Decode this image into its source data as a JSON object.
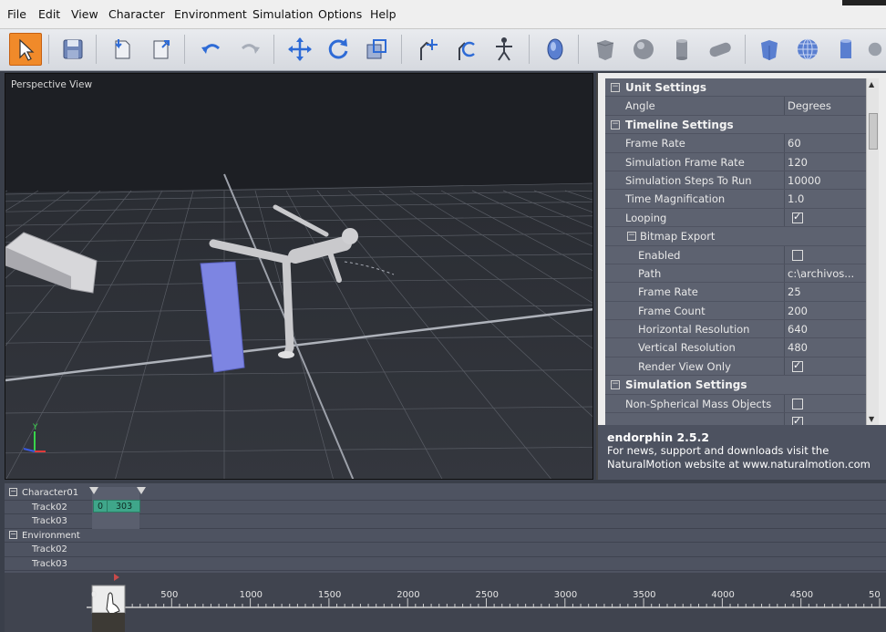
{
  "menu": [
    "File",
    "Edit",
    "View",
    "Character",
    "Environment",
    "Simulation",
    "Options",
    "Help"
  ],
  "toolbar": {
    "tools": [
      "select-tool",
      "save-tool",
      "open-tool",
      "export-tool",
      "undo-tool",
      "redo-tool",
      "move-tool",
      "rotate-tool",
      "scale-tool",
      "character-pose-tool",
      "character-rotate-tool",
      "character-tool",
      "head-object-tool",
      "box-object-tool",
      "sphere-object-tool",
      "cylinder-object-tool",
      "capsule-object-tool",
      "cube-env-tool",
      "globe-env-tool",
      "column-env-tool",
      "extra-tool"
    ]
  },
  "viewport": {
    "label": "Perspective View",
    "axis_y": "Y"
  },
  "properties": {
    "rows": [
      {
        "type": "section",
        "key": "Unit Settings"
      },
      {
        "type": "prop",
        "key": "Angle",
        "value": "Degrees"
      },
      {
        "type": "section",
        "key": "Timeline Settings"
      },
      {
        "type": "prop",
        "key": "Frame Rate",
        "value": "60"
      },
      {
        "type": "prop",
        "key": "Simulation Frame Rate",
        "value": "120"
      },
      {
        "type": "prop",
        "key": "Simulation Steps To Run",
        "value": "10000"
      },
      {
        "type": "prop",
        "key": "Time Magnification",
        "value": "1.0"
      },
      {
        "type": "check",
        "key": "Looping",
        "checked": true
      },
      {
        "type": "sub",
        "key": "Bitmap Export"
      },
      {
        "type": "check",
        "key": "Enabled",
        "checked": false,
        "indent": true
      },
      {
        "type": "prop",
        "key": "Path",
        "value": "c:\\archivos...",
        "indent": true
      },
      {
        "type": "prop",
        "key": "Frame Rate",
        "value": "25",
        "indent": true
      },
      {
        "type": "prop",
        "key": "Frame Count",
        "value": "200",
        "indent": true
      },
      {
        "type": "prop",
        "key": "Horizontal Resolution",
        "value": "640",
        "indent": true
      },
      {
        "type": "prop",
        "key": "Vertical Resolution",
        "value": "480",
        "indent": true
      },
      {
        "type": "check",
        "key": "Render View Only",
        "checked": true,
        "indent": true
      },
      {
        "type": "section",
        "key": "Simulation Settings"
      },
      {
        "type": "check",
        "key": "Non-Spherical Mass Objects",
        "checked": false
      },
      {
        "type": "check",
        "key": "",
        "checked": true
      }
    ]
  },
  "info": {
    "title": "endorphin 2.5.2",
    "line1": "For news, support and downloads visit the",
    "line2": "NaturalMotion website at www.naturalmotion.com"
  },
  "timeline": {
    "rows": [
      {
        "label": "Character01",
        "group": true
      },
      {
        "label": "Track02",
        "group": false
      },
      {
        "label": "Track03",
        "group": false
      },
      {
        "label": "Environment",
        "group": true
      },
      {
        "label": "Track02",
        "group": false
      },
      {
        "label": "Track03",
        "group": false
      }
    ],
    "clip": {
      "start": "0",
      "end": "303"
    },
    "ruler_ticks": [
      "0",
      "500",
      "1000",
      "1500",
      "2000",
      "2500",
      "3000",
      "3500",
      "4000",
      "4500",
      "50"
    ]
  },
  "colors": {
    "accent": "#f08a2a",
    "grid_bg": "#5d6270",
    "clip": "#3fa68a"
  }
}
